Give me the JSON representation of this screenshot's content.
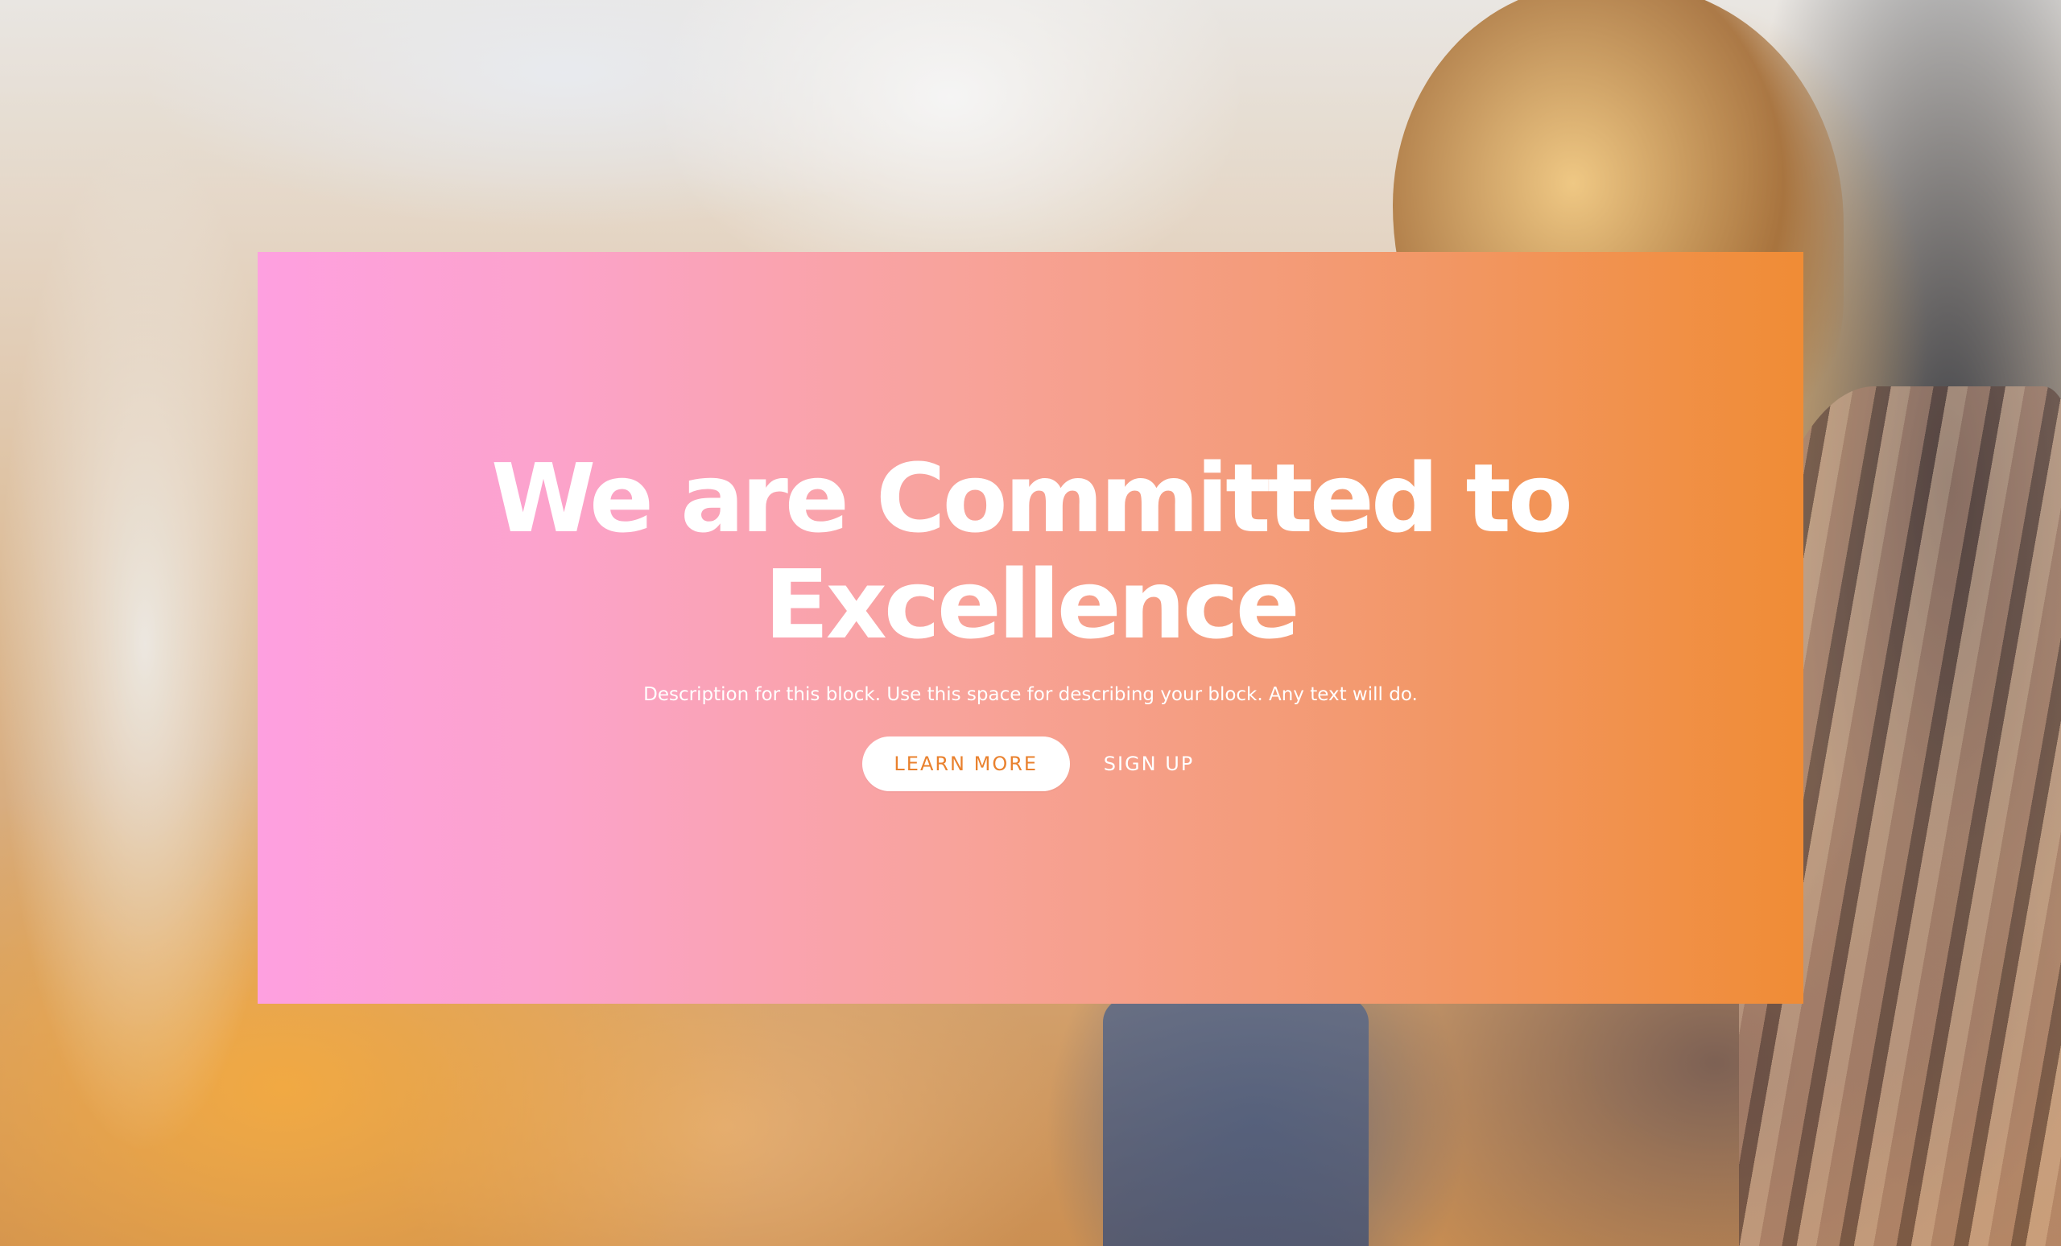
{
  "hero": {
    "headline": "We are Committed to Excellence",
    "description": "Description for this block. Use this space for describing your block. Any text will do.",
    "buttons": {
      "primary_label": "LEARN MORE",
      "secondary_label": "SIGN UP"
    },
    "colors": {
      "gradient_start": "#fea0e0",
      "gradient_end": "#f08c35",
      "primary_button_text": "#e9812e",
      "text": "#ffffff"
    }
  }
}
